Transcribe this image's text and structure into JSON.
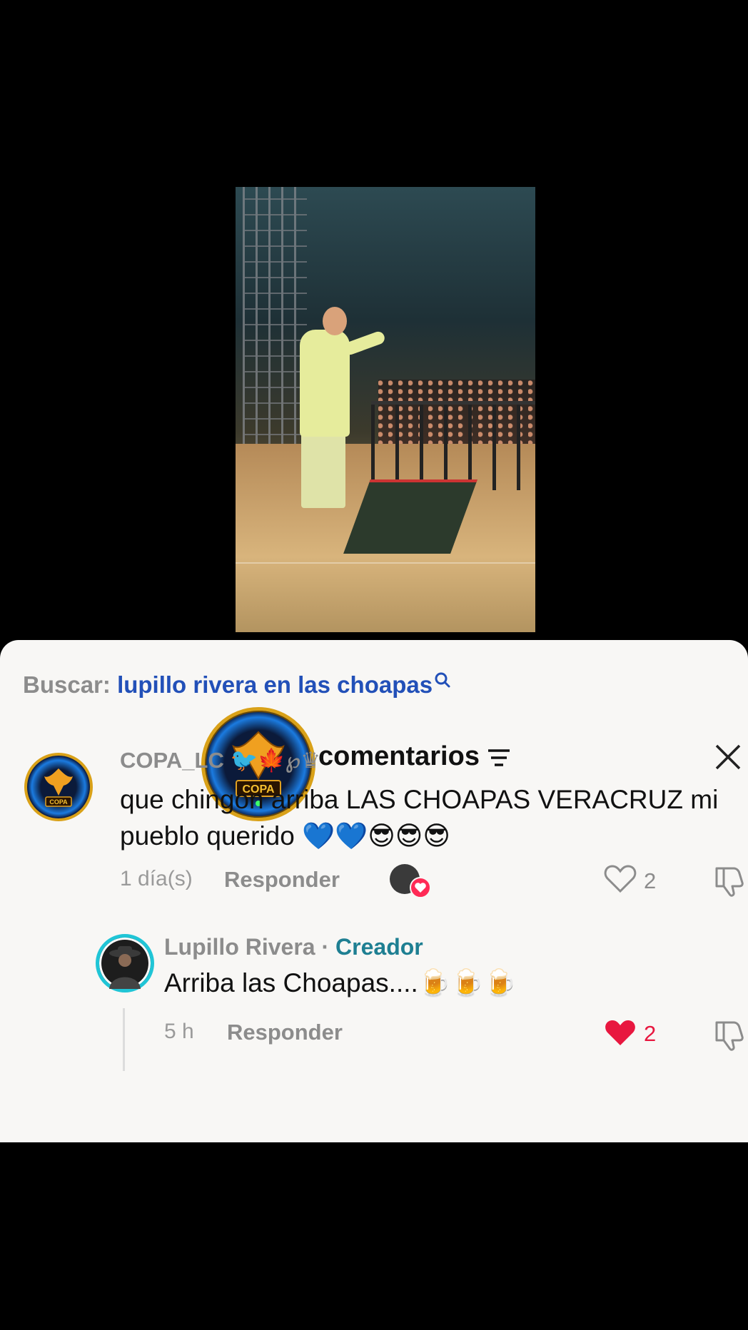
{
  "search": {
    "label": "Buscar:",
    "query": "lupillo rivera en las choapas"
  },
  "header": {
    "title": "comentarios",
    "avatar_text": "COPA"
  },
  "comment": {
    "username": "COPA_LC",
    "username_emoji": "🐦🍁℘♛",
    "avatar_text": "COPA",
    "text": "que chingon arriba LAS CHOAPAS VERACRUZ mi pueblo querido 💙💙😎😎😎",
    "time": "1 día(s)",
    "reply_label": "Responder",
    "likes": "2"
  },
  "reply": {
    "username": "Lupillo Rivera",
    "separator": "·",
    "creator_label": "Creador",
    "text": "Arriba las Choapas....🍺🍺🍺",
    "time": "5 h",
    "reply_label": "Responder",
    "likes": "2"
  },
  "colors": {
    "search_link": "#2250b8",
    "creator": "#1e7f92",
    "liked_heart": "#e8173f",
    "sheet_bg": "#f8f7f5"
  }
}
